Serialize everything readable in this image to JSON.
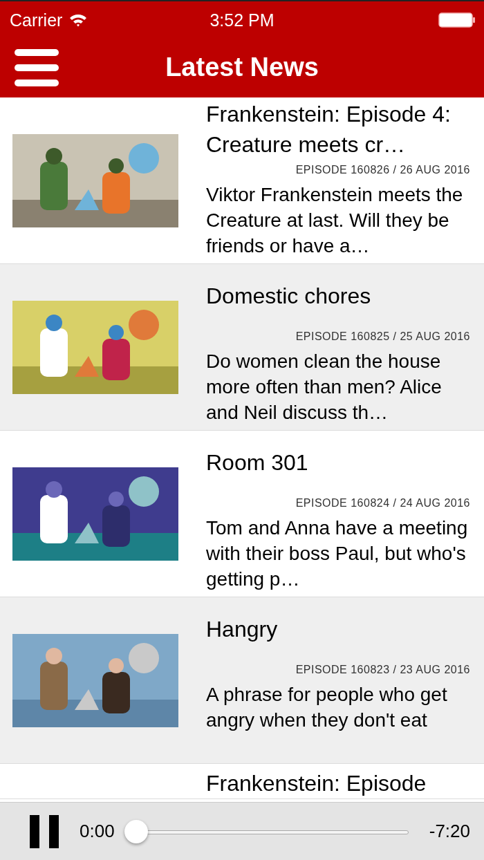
{
  "status_bar": {
    "carrier": "Carrier",
    "time": "3:52 PM"
  },
  "nav": {
    "title": "Latest News"
  },
  "articles": [
    {
      "title": "Frankenstein: Episode 4: Creature meets cr…",
      "meta": "EPISODE 160826 / 26 AUG 2016",
      "description": "Viktor Frankenstein meets the Creature at last. Will they be friends or have a…"
    },
    {
      "title": "Domestic chores",
      "meta": "EPISODE 160825 / 25 AUG 2016",
      "description": "Do women clean the house more often than men? Alice and Neil discuss th…"
    },
    {
      "title": "Room 301",
      "meta": "EPISODE 160824 / 24 AUG 2016",
      "description": "Tom and Anna have a meeting with their boss Paul, but who's getting p…"
    },
    {
      "title": "Hangry",
      "meta": "EPISODE 160823 / 23 AUG 2016",
      "description": "A phrase for people who get angry when they don't eat"
    },
    {
      "title": "Frankenstein: Episode"
    }
  ],
  "player": {
    "elapsed": "0:00",
    "remaining": "-7:20",
    "level": 0
  }
}
